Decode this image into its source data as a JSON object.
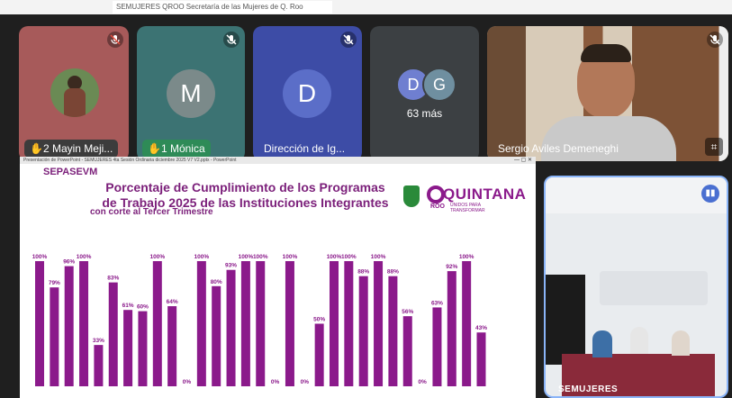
{
  "header": {
    "banner_text": "SEMUJERES QROO Secretaría de las Mujeres de Q. Roo"
  },
  "participants": [
    {
      "label": "2 Mayin Meji...",
      "kind": "photo"
    },
    {
      "label": "1 Mónica",
      "initial": "M",
      "kind": "initial"
    },
    {
      "label": "Dirección de Ig...",
      "initial": "D",
      "kind": "initial"
    },
    {
      "initials": [
        "D",
        "G"
      ],
      "more": "63 más",
      "kind": "group"
    },
    {
      "label": "Sergio Aviles Demeneghi",
      "kind": "video"
    }
  ],
  "slide": {
    "window_title": "Presentación de PowerPoint - SEMUJERES 4ta Sesión Ordinaria diciembre 2025 V7 V2.pptx - PowerPoint",
    "tag": "SEPASEVM",
    "title_line1": "Porcentaje de Cumplimiento de los Programas",
    "title_line2": "de Trabajo 2025 de las Instituciones Integrantes",
    "subtitle": "con corte al Tercer Trimestre",
    "logo_word1": "QUINTANA",
    "logo_word2": "ROO",
    "logo_tagline": "UNIDOS PARA TRANSFORMAR"
  },
  "chart_data": {
    "type": "bar",
    "ylim": [
      0,
      100
    ],
    "values": [
      100,
      79,
      96,
      100,
      33,
      83,
      61,
      60,
      100,
      64,
      0,
      100,
      80,
      93,
      100,
      100,
      0,
      100,
      0,
      50,
      100,
      100,
      88,
      100,
      88,
      56,
      0,
      63,
      92,
      100,
      43
    ],
    "labels": [
      "100%",
      "79%",
      "96%",
      "100%",
      "33%",
      "83%",
      "61%",
      "60%",
      "100%",
      "64%",
      "0%",
      "100%",
      "80%",
      "93%",
      "100%",
      "100%",
      "0%",
      "100%",
      "0%",
      "50%",
      "100%",
      "100%",
      "88%",
      "100%",
      "88%",
      "56%",
      "0%",
      "63%",
      "92%",
      "100%",
      "43%"
    ],
    "bar_color": "#8b1a8b"
  },
  "selfview": {
    "name": "SEMUJERES"
  },
  "colors": {
    "accent": "#7b1f7a",
    "stage": "#1f1f1f",
    "selected_border": "#8ab4f8"
  }
}
